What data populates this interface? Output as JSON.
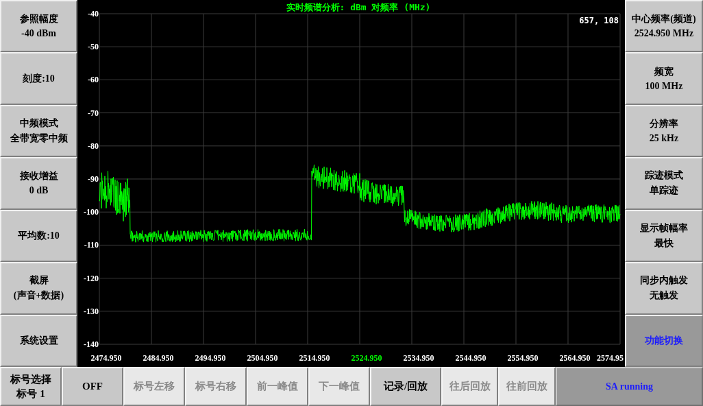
{
  "left_buttons": [
    {
      "lines": [
        "参照幅度",
        "-40 dBm"
      ]
    },
    {
      "lines": [
        "刻度:10"
      ]
    },
    {
      "lines": [
        "中频模式",
        "全带宽零中频"
      ]
    },
    {
      "lines": [
        "接收增益",
        "0 dB"
      ]
    },
    {
      "lines": [
        "平均数:10"
      ]
    },
    {
      "lines": [
        "截屏",
        "(声音+数据)"
      ]
    },
    {
      "lines": [
        "系统设置"
      ]
    }
  ],
  "chart": {
    "title": "实时频谱分析: dBm 对频率 (MHz)",
    "cursor_readout": "657, 108",
    "y_ticks": [
      "-40",
      "-50",
      "-60",
      "-70",
      "-80",
      "-90",
      "-100",
      "-110",
      "-120",
      "-130",
      "-140"
    ],
    "x_ticks": [
      {
        "label": "2474.950",
        "highlighted": false
      },
      {
        "label": "2484.950",
        "highlighted": false
      },
      {
        "label": "2494.950",
        "highlighted": false
      },
      {
        "label": "2504.950",
        "highlighted": false
      },
      {
        "label": "2514.950",
        "highlighted": false
      },
      {
        "label": "2524.950",
        "highlighted": true
      },
      {
        "label": "2534.950",
        "highlighted": false
      },
      {
        "label": "2544.950",
        "highlighted": false
      },
      {
        "label": "2554.950",
        "highlighted": false
      },
      {
        "label": "2564.950",
        "highlighted": false
      },
      {
        "label": "2574.95",
        "highlighted": false
      }
    ]
  },
  "right_buttons": [
    {
      "lines": [
        "中心频率(频道)",
        "2524.950 MHz"
      ],
      "active": false
    },
    {
      "lines": [
        "频宽",
        "100 MHz"
      ],
      "active": false
    },
    {
      "lines": [
        "分辨率",
        "25 kHz"
      ],
      "active": false
    },
    {
      "lines": [
        "踪迹模式",
        "单踪迹"
      ],
      "active": false
    },
    {
      "lines": [
        "显示帧幅率",
        "最快"
      ],
      "active": false
    },
    {
      "lines": [
        "同步内触发",
        "无触发"
      ],
      "active": false
    },
    {
      "lines": [
        "功能切换"
      ],
      "active": true
    }
  ],
  "bottom_bar": [
    {
      "kind": "button",
      "lines": [
        "标号选择",
        "标号 1"
      ],
      "disabled": false
    },
    {
      "kind": "button",
      "lines": [
        "OFF"
      ],
      "disabled": false
    },
    {
      "kind": "button",
      "lines": [
        "标号左移"
      ],
      "disabled": true
    },
    {
      "kind": "button",
      "lines": [
        "标号右移"
      ],
      "disabled": true
    },
    {
      "kind": "button",
      "lines": [
        "前一峰值"
      ],
      "disabled": true
    },
    {
      "kind": "button",
      "lines": [
        "下一峰值"
      ],
      "disabled": true
    },
    {
      "kind": "button",
      "lines": [
        "记录/回放"
      ],
      "disabled": false
    },
    {
      "kind": "button",
      "lines": [
        "往后回放"
      ],
      "disabled": true
    },
    {
      "kind": "button",
      "lines": [
        "往前回放"
      ],
      "disabled": true
    },
    {
      "kind": "status",
      "lines": [
        "SA running"
      ]
    }
  ]
}
